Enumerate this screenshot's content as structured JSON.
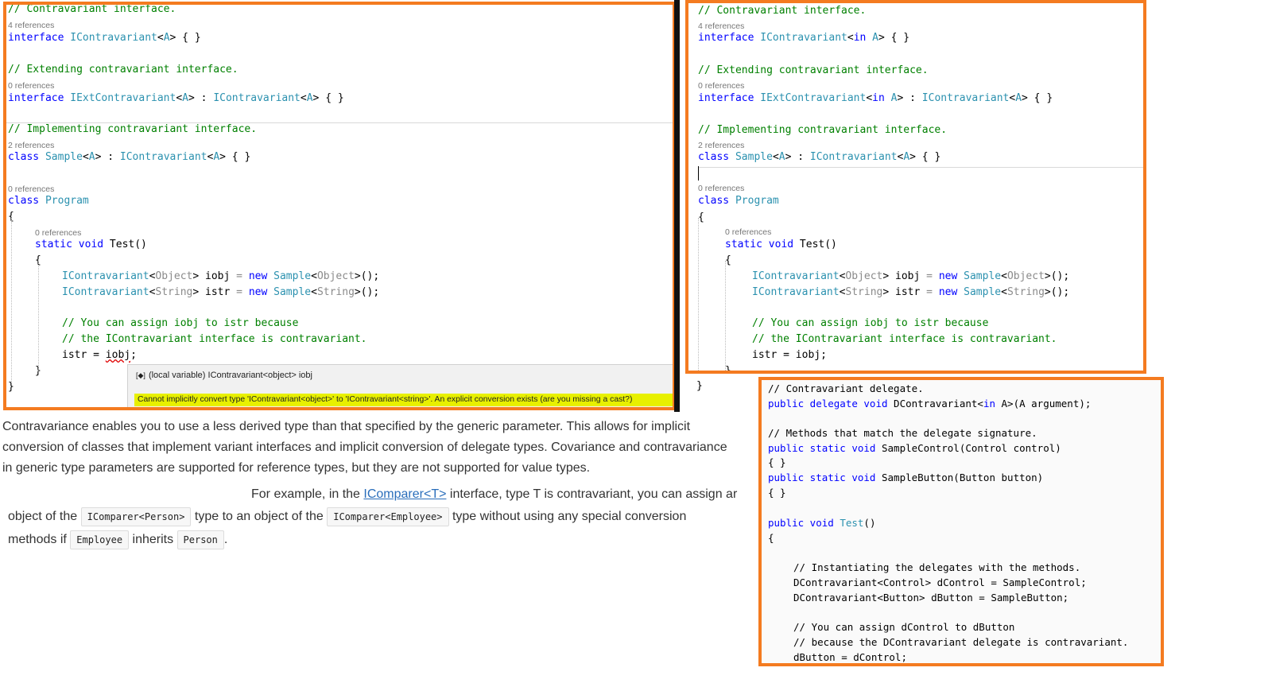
{
  "panel1": {
    "lines": [
      {
        "t": "comment",
        "text": "// Contravariant interface."
      },
      {
        "t": "refs",
        "text": "4 references"
      },
      {
        "t": "code",
        "segs": [
          [
            "kw",
            "interface "
          ],
          [
            "ty",
            "IContravariant"
          ],
          [
            "",
            "<"
          ],
          [
            "ty",
            "A"
          ],
          [
            "",
            "> { }"
          ]
        ]
      },
      {
        "t": "comment",
        "text": "// Extending contravariant interface."
      },
      {
        "t": "refs",
        "text": "0 references"
      },
      {
        "t": "code",
        "segs": [
          [
            "kw",
            "interface "
          ],
          [
            "ty",
            "IExtContravariant"
          ],
          [
            "",
            "<"
          ],
          [
            "ty",
            "A"
          ],
          [
            "",
            "> : "
          ],
          [
            "ty",
            "IContravariant"
          ],
          [
            "",
            "<"
          ],
          [
            "ty",
            "A"
          ],
          [
            "",
            "> { }"
          ]
        ]
      },
      {
        "t": "comment",
        "text": "// Implementing contravariant interface."
      },
      {
        "t": "refs",
        "text": "2 references"
      },
      {
        "t": "code",
        "segs": [
          [
            "kw",
            "class "
          ],
          [
            "ty",
            "Sample"
          ],
          [
            "",
            "<"
          ],
          [
            "ty",
            "A"
          ],
          [
            "",
            "> : "
          ],
          [
            "ty",
            "IContravariant"
          ],
          [
            "",
            "<"
          ],
          [
            "ty",
            "A"
          ],
          [
            "",
            "> { }"
          ]
        ]
      },
      {
        "t": "refs",
        "text": "0 references"
      },
      {
        "t": "code",
        "segs": [
          [
            "kw",
            "class "
          ],
          [
            "ty",
            "Program"
          ]
        ]
      },
      {
        "t": "code",
        "segs": [
          [
            "",
            "{"
          ]
        ]
      },
      {
        "t": "refs",
        "text": "0 references"
      },
      {
        "t": "code",
        "segs": [
          [
            "kw",
            "static void "
          ],
          [
            "",
            "Test()"
          ]
        ]
      },
      {
        "t": "code",
        "segs": [
          [
            "",
            "{"
          ]
        ]
      },
      {
        "t": "code",
        "segs": [
          [
            "ty",
            "IContravariant"
          ],
          [
            "",
            "<"
          ],
          [
            "gr",
            "Object"
          ],
          [
            "",
            "> iobj "
          ],
          [
            "gr",
            "="
          ],
          [
            "kw",
            " new "
          ],
          [
            "ty",
            "Sample"
          ],
          [
            "",
            "<"
          ],
          [
            "gr",
            "Object"
          ],
          [
            "",
            ">();"
          ]
        ]
      },
      {
        "t": "code",
        "segs": [
          [
            "ty",
            "IContravariant"
          ],
          [
            "",
            "<"
          ],
          [
            "gr",
            "String"
          ],
          [
            "",
            "> istr "
          ],
          [
            "gr",
            "="
          ],
          [
            "kw",
            " new "
          ],
          [
            "ty",
            "Sample"
          ],
          [
            "",
            "<"
          ],
          [
            "gr",
            "String"
          ],
          [
            "",
            ">();"
          ]
        ]
      },
      {
        "t": "comment",
        "text": "// You can assign iobj to istr because"
      },
      {
        "t": "comment",
        "text": "// the IContravariant interface is contravariant."
      },
      {
        "t": "code",
        "segs": [
          [
            "",
            "istr = "
          ],
          [
            "rd",
            "iobj"
          ],
          [
            "",
            ";"
          ]
        ]
      },
      {
        "t": "code",
        "segs": [
          [
            "",
            "}"
          ]
        ]
      },
      {
        "t": "code",
        "segs": [
          [
            "",
            "}"
          ]
        ]
      }
    ],
    "tooltip_info": "(local variable) IContravariant<object> iobj",
    "tooltip_error": "Cannot implicitly convert type 'IContravariant<object>' to 'IContravariant<string>'. An explicit conversion exists (are you missing a cast?)"
  },
  "panel2": {
    "lines": [
      {
        "t": "comment",
        "text": "// Contravariant interface."
      },
      {
        "t": "refs",
        "text": "4 references"
      },
      {
        "t": "code",
        "segs": [
          [
            "kw",
            "interface "
          ],
          [
            "ty",
            "IContravariant"
          ],
          [
            "",
            "<"
          ],
          [
            "kw",
            "in "
          ],
          [
            "ty",
            "A"
          ],
          [
            "",
            "> { }"
          ]
        ]
      },
      {
        "t": "comment",
        "text": "// Extending contravariant interface."
      },
      {
        "t": "refs",
        "text": "0 references"
      },
      {
        "t": "code",
        "segs": [
          [
            "kw",
            "interface "
          ],
          [
            "ty",
            "IExtContravariant"
          ],
          [
            "",
            "<"
          ],
          [
            "kw",
            "in "
          ],
          [
            "ty",
            "A"
          ],
          [
            "",
            "> : "
          ],
          [
            "ty",
            "IContravariant"
          ],
          [
            "",
            "<"
          ],
          [
            "ty",
            "A"
          ],
          [
            "",
            "> { }"
          ]
        ]
      },
      {
        "t": "comment",
        "text": "// Implementing contravariant interface."
      },
      {
        "t": "refs",
        "text": "2 references"
      },
      {
        "t": "code",
        "segs": [
          [
            "kw",
            "class "
          ],
          [
            "ty",
            "Sample"
          ],
          [
            "",
            "<"
          ],
          [
            "ty",
            "A"
          ],
          [
            "",
            "> : "
          ],
          [
            "ty",
            "IContravariant"
          ],
          [
            "",
            "<"
          ],
          [
            "ty",
            "A"
          ],
          [
            "",
            "> { }"
          ]
        ]
      },
      {
        "t": "refs",
        "text": "0 references"
      },
      {
        "t": "code",
        "segs": [
          [
            "kw",
            "class "
          ],
          [
            "ty",
            "Program"
          ]
        ]
      },
      {
        "t": "code",
        "segs": [
          [
            "",
            "{"
          ]
        ]
      },
      {
        "t": "refs",
        "text": "0 references"
      },
      {
        "t": "code",
        "segs": [
          [
            "kw",
            "static void "
          ],
          [
            "",
            "Test()"
          ]
        ]
      },
      {
        "t": "code",
        "segs": [
          [
            "",
            "{"
          ]
        ]
      },
      {
        "t": "code",
        "segs": [
          [
            "ty",
            "IContravariant"
          ],
          [
            "",
            "<"
          ],
          [
            "gr",
            "Object"
          ],
          [
            "",
            "> iobj "
          ],
          [
            "gr",
            "="
          ],
          [
            "kw",
            " new "
          ],
          [
            "ty",
            "Sample"
          ],
          [
            "",
            "<"
          ],
          [
            "gr",
            "Object"
          ],
          [
            "",
            ">();"
          ]
        ]
      },
      {
        "t": "code",
        "segs": [
          [
            "ty",
            "IContravariant"
          ],
          [
            "",
            "<"
          ],
          [
            "gr",
            "String"
          ],
          [
            "",
            "> istr "
          ],
          [
            "gr",
            "="
          ],
          [
            "kw",
            " new "
          ],
          [
            "ty",
            "Sample"
          ],
          [
            "",
            "<"
          ],
          [
            "gr",
            "String"
          ],
          [
            "",
            ">();"
          ]
        ]
      },
      {
        "t": "comment",
        "text": "// You can assign iobj to istr because"
      },
      {
        "t": "comment",
        "text": "// the IContravariant interface is contravariant."
      },
      {
        "t": "code",
        "segs": [
          [
            "",
            "istr = iobj;"
          ]
        ]
      },
      {
        "t": "code",
        "segs": [
          [
            "",
            "}"
          ]
        ]
      },
      {
        "t": "code",
        "segs": [
          [
            "",
            "}"
          ]
        ]
      }
    ]
  },
  "panel4": {
    "lines": [
      {
        "t": "comment",
        "text": "// Contravariant delegate."
      },
      {
        "t": "code",
        "segs": [
          [
            "kw",
            "public delegate void "
          ],
          [
            "",
            "DContravariant<"
          ],
          [
            "kw",
            "in "
          ],
          [
            "",
            "A>(A argument);"
          ]
        ]
      },
      {
        "t": "comment",
        "text": "// Methods that match the delegate signature."
      },
      {
        "t": "code",
        "segs": [
          [
            "kw",
            "public static void "
          ],
          [
            "",
            "SampleControl(Control control)"
          ]
        ]
      },
      {
        "t": "code",
        "segs": [
          [
            "",
            "{ }"
          ]
        ]
      },
      {
        "t": "code",
        "segs": [
          [
            "kw",
            "public static void "
          ],
          [
            "",
            "SampleButton(Button button)"
          ]
        ]
      },
      {
        "t": "code",
        "segs": [
          [
            "",
            "{ }"
          ]
        ]
      },
      {
        "t": "code",
        "segs": [
          [
            "kw",
            "public void "
          ],
          [
            "ty",
            "Test"
          ],
          [
            "",
            "()"
          ]
        ]
      },
      {
        "t": "code",
        "segs": [
          [
            "",
            "{"
          ]
        ]
      },
      {
        "t": "comment",
        "text": "// Instantiating the delegates with the methods."
      },
      {
        "t": "code",
        "segs": [
          [
            "",
            "DContravariant<Control> dControl = SampleControl;"
          ]
        ]
      },
      {
        "t": "code",
        "segs": [
          [
            "",
            "DContravariant<Button> dButton = SampleButton;"
          ]
        ]
      },
      {
        "t": "comment",
        "text": "// You can assign dControl to dButton"
      },
      {
        "t": "comment",
        "text": "// because the DContravariant delegate is contravariant."
      },
      {
        "t": "code",
        "segs": [
          [
            "",
            "dButton = dControl;"
          ]
        ]
      }
    ]
  },
  "article": {
    "para1_line1": "Contravariance enables you to use a less derived type than that specified by the generic parameter. This allows for implicit",
    "para1_line2": "conversion of classes that implement variant interfaces and implicit conversion of delegate types. Covariance and contravariance",
    "para1_line3": "in generic type parameters are supported for reference types, but they are not supported for value types.",
    "p2_prefix": "For example, in the ",
    "p2_link": "IComparer<T>",
    "p2_suffix": " interface, type T is contravariant, you can assign ar",
    "p3_a": "object of the ",
    "chip1": "IComparer<Person>",
    "p3_b": " type to an object of the ",
    "chip2": "IComparer<Employee>",
    "p3_c": " type without using any special conversion",
    "p4_a": "methods if ",
    "chip3": "Employee",
    "p4_b": " inherits ",
    "chip4": "Person",
    "p4_c": "."
  },
  "colors": {
    "border_orange": "#f47b20",
    "keyword_blue": "#0000ff",
    "type_teal": "#2b91af",
    "comment_green": "#008000",
    "error_yellow": "#e8f000"
  }
}
